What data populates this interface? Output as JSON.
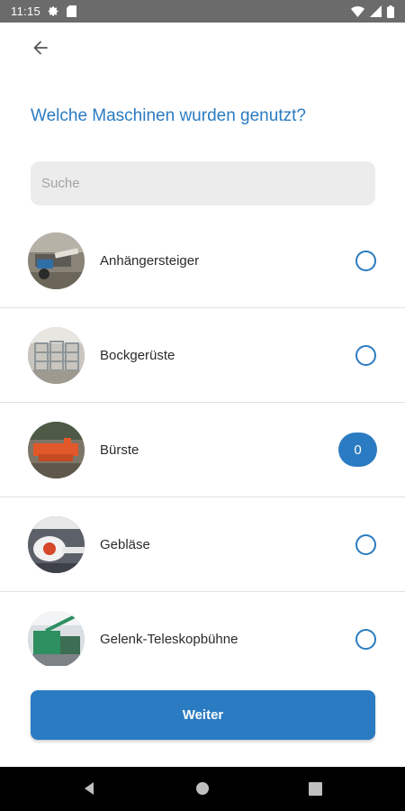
{
  "status_bar": {
    "time": "11:15",
    "icons": [
      "gear-icon",
      "sd-card-icon",
      "wifi-icon",
      "signal-icon",
      "battery-icon"
    ]
  },
  "header": {
    "back_icon": "arrow-left-icon",
    "title": "Welche Maschinen wurden genutzt?"
  },
  "search": {
    "placeholder": "Suche",
    "value": ""
  },
  "machines": [
    {
      "label": "Anhängersteiger",
      "selected": false,
      "count": null
    },
    {
      "label": "Bockgerüste",
      "selected": false,
      "count": null
    },
    {
      "label": "Bürste",
      "selected": true,
      "count": "0"
    },
    {
      "label": "Gebläse",
      "selected": false,
      "count": null
    },
    {
      "label": "Gelenk-Teleskopbühne",
      "selected": false,
      "count": null
    }
  ],
  "footer": {
    "next_label": "Weiter"
  },
  "nav_bar": {
    "icons": [
      "back-triangle-icon",
      "home-circle-icon",
      "recents-square-icon"
    ]
  },
  "colors": {
    "accent": "#2a7bc2",
    "status_bar": "#6b6b6b",
    "search_bg": "#ececec",
    "nav_bar": "#000000"
  }
}
